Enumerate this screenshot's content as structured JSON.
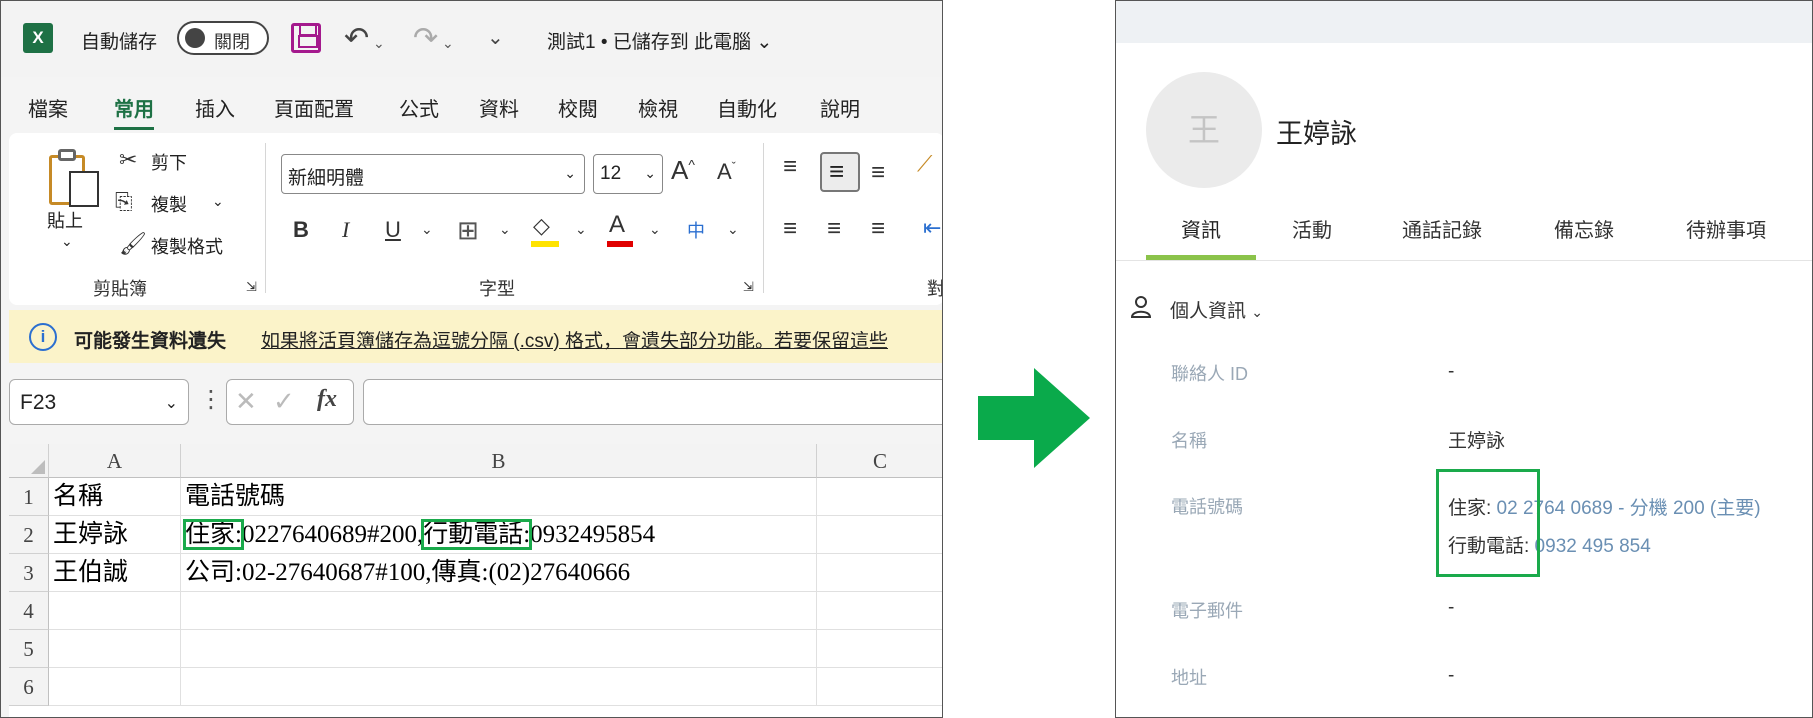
{
  "excel": {
    "autosave_label": "自動儲存",
    "autosave_state": "關閉",
    "doc_title": "測試1 • 已儲存到 此電腦",
    "menu": [
      "檔案",
      "常用",
      "插入",
      "頁面配置",
      "公式",
      "資料",
      "校閱",
      "檢視",
      "自動化",
      "說明"
    ],
    "ribbon": {
      "cut": "剪下",
      "copy": "複製",
      "format_painter": "複製格式",
      "paste": "貼上",
      "clipboard_group": "剪貼簿",
      "font_name": "新細明體",
      "font_size": "12",
      "font_group": "字型",
      "next_group_partial": "對"
    },
    "info_bar": {
      "title": "可能發生資料遺失",
      "message": "如果將活頁簿儲存為逗號分隔 (.csv) 格式，會遺失部分功能。若要保留這些"
    },
    "name_box": "F23",
    "columns": [
      "A",
      "B",
      "C"
    ],
    "rows": [
      "1",
      "2",
      "3",
      "4",
      "5",
      "6"
    ],
    "cells": {
      "A1": "名稱",
      "B1": "電話號碼",
      "A2": "王婷詠",
      "B2_p1": "住家:",
      "B2_p2": "0227640689#200,",
      "B2_p3": "行動電話:",
      "B2_p4": "0932495854",
      "A3": "王伯誠",
      "B3": "公司:02-27640687#100,傳真:(02)27640666"
    }
  },
  "crm": {
    "avatar_initial": "王",
    "name": "王婷詠",
    "tabs": [
      "資訊",
      "活動",
      "通話記錄",
      "備忘錄",
      "待辦事項"
    ],
    "section_title": "個人資訊",
    "fields": {
      "contact_id_label": "聯絡人 ID",
      "contact_id_value": "-",
      "name_label": "名稱",
      "name_value": "王婷詠",
      "phone_label": "電話號碼",
      "phone1_type": "住家:",
      "phone1_value": " 02 2764 0689 - 分機 200 (主要)",
      "phone2_type": "行動電話:",
      "phone2_value": " 0932 495 854",
      "email_label": "電子郵件",
      "email_value": "-",
      "address_label": "地址",
      "address_value": "-"
    }
  },
  "colors": {
    "excel_green": "#1e7145",
    "highlight_green": "#1aaa4b",
    "arrow_green": "#0aaa4b",
    "crm_tab_indicator": "#8bc34a",
    "crm_link": "#6a8fb3",
    "info_bar_bg": "#fbf3c9"
  }
}
